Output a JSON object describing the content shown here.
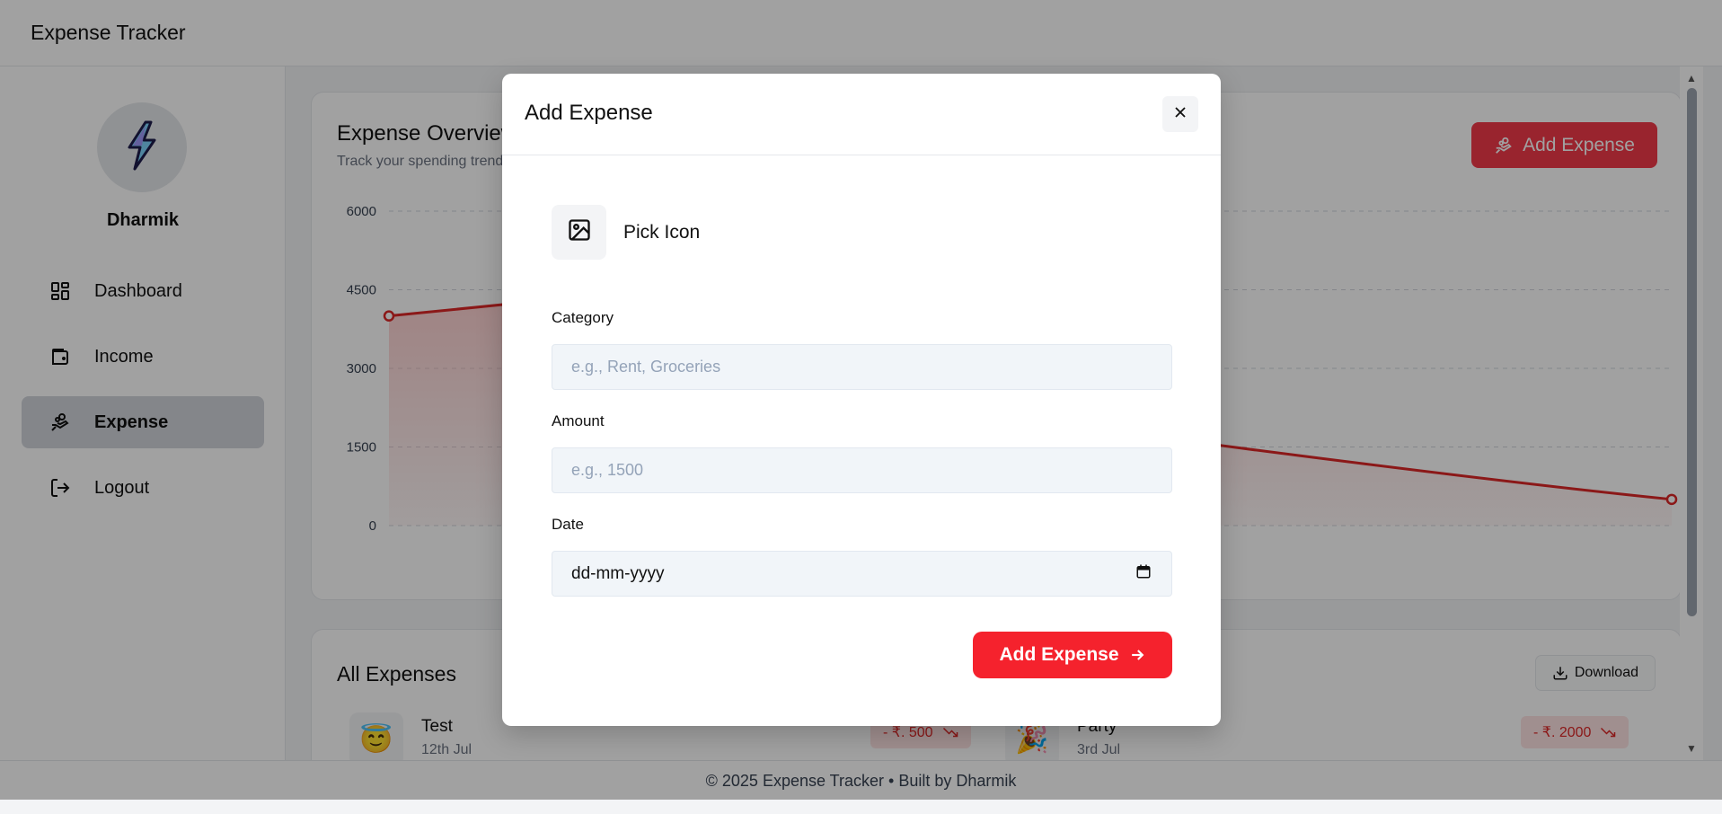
{
  "header": {
    "app_title": "Expense Tracker"
  },
  "sidebar": {
    "username": "Dharmik",
    "items": [
      {
        "label": "Dashboard",
        "icon": "dashboard-icon",
        "active": false
      },
      {
        "label": "Income",
        "icon": "wallet-icon",
        "active": false
      },
      {
        "label": "Expense",
        "icon": "hand-coins-icon",
        "active": true
      },
      {
        "label": "Logout",
        "icon": "logout-icon",
        "active": false
      }
    ]
  },
  "overview": {
    "title": "Expense Overview",
    "subtitle": "Track your spending trends over time",
    "add_button_label": "Add Expense"
  },
  "chart_data": {
    "type": "area",
    "y_ticks": [
      "6000",
      "4500",
      "3000",
      "1500",
      "0"
    ],
    "ylim": [
      0,
      6000
    ],
    "series": [
      {
        "values": [
          4000,
          4400,
          500
        ],
        "points_visible": [
          "first",
          "last"
        ]
      }
    ],
    "grid": true,
    "color": "#dc2626"
  },
  "all_expenses": {
    "title": "All Expenses",
    "download_label": "Download",
    "items": [
      {
        "emoji": "😇",
        "name": "Test",
        "date": "12th Jul",
        "amount": "- ₹. 500"
      },
      {
        "emoji": "🎉",
        "name": "Party",
        "date": "3rd Jul",
        "amount": "- ₹. 2000"
      }
    ]
  },
  "footer": {
    "text": "© 2025 Expense Tracker • Built by Dharmik"
  },
  "modal": {
    "title": "Add Expense",
    "pick_icon_label": "Pick Icon",
    "fields": {
      "category": {
        "label": "Category",
        "placeholder": "e.g., Rent, Groceries",
        "value": ""
      },
      "amount": {
        "label": "Amount",
        "placeholder": "e.g., 1500",
        "value": ""
      },
      "date": {
        "label": "Date",
        "placeholder": "dd-mm-yyyy"
      }
    },
    "submit_label": "Add Expense"
  },
  "colors": {
    "accent": "#f23a4a",
    "overlay": "rgba(0,0,0,0.37)"
  }
}
